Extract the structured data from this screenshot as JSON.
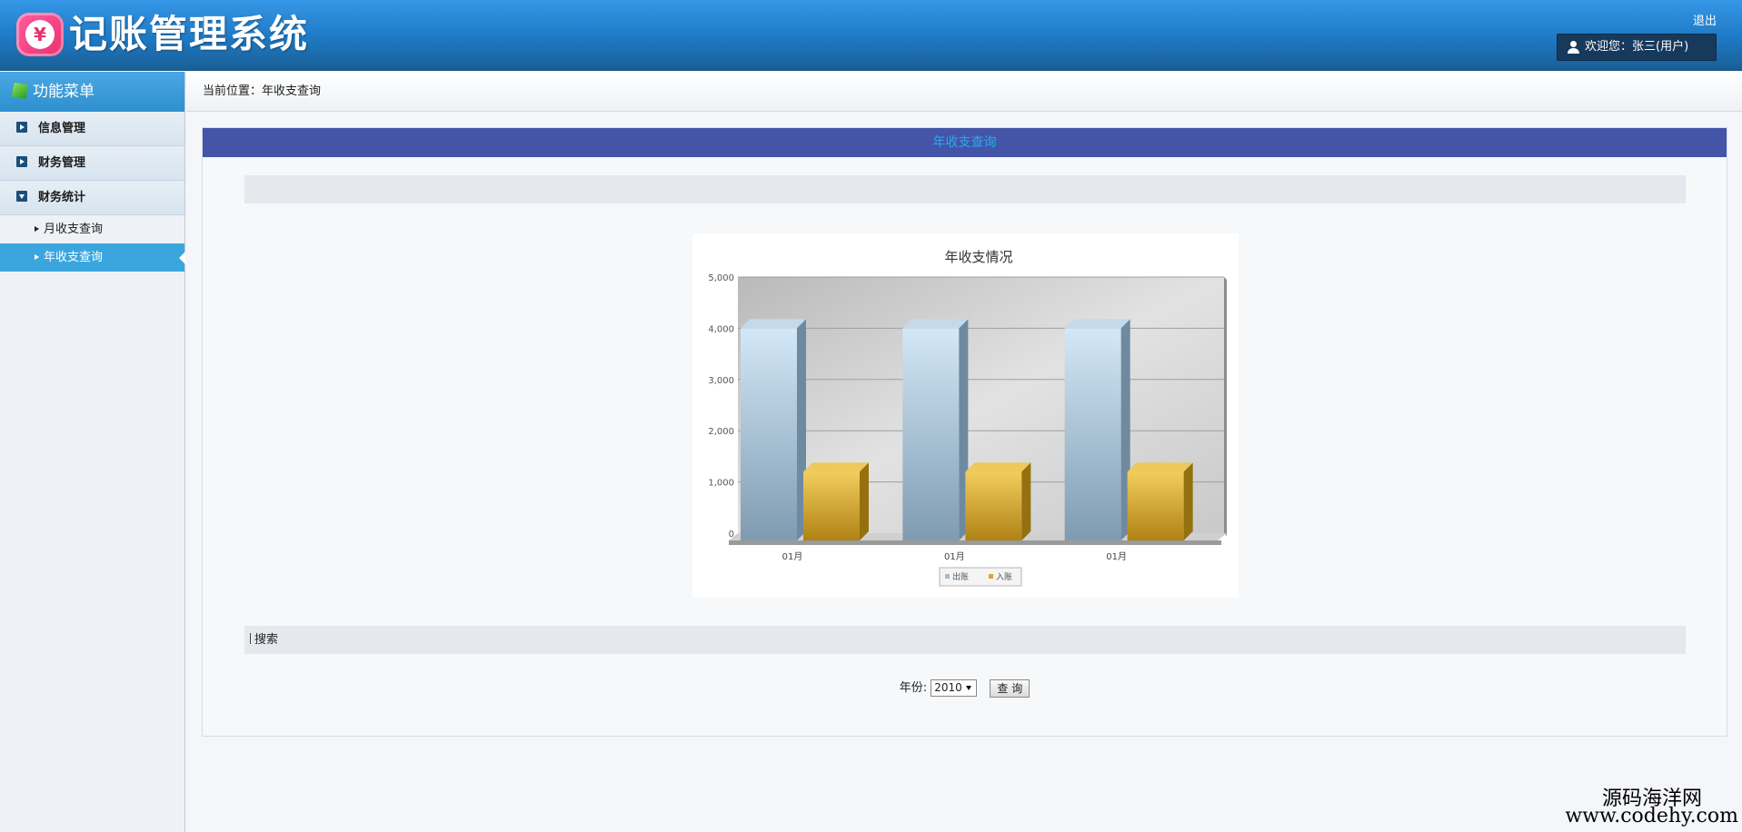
{
  "header": {
    "app_title": "记账管理系统",
    "logo_glyph": "¥",
    "logout_label": "退出",
    "welcome_text": "欢迎您：张三(用户)"
  },
  "sidebar": {
    "title": "功能菜单",
    "groups": [
      {
        "label": "信息管理",
        "expanded": false
      },
      {
        "label": "财务管理",
        "expanded": false
      },
      {
        "label": "财务统计",
        "expanded": true
      }
    ],
    "sub_items": [
      {
        "label": "月收支查询",
        "active": false
      },
      {
        "label": "年收支查询",
        "active": true
      }
    ]
  },
  "breadcrumb": {
    "text": "当前位置：年收支查询"
  },
  "panel": {
    "title": "年收支查询"
  },
  "search": {
    "section_label": "搜索",
    "year_label": "年份:",
    "year_value": "2010",
    "submit_label": "查 询"
  },
  "watermark": {
    "line1": "源码海洋网",
    "line2": "www.codehy.com"
  },
  "colors": {
    "expense": "#9fbad0",
    "income": "#d7a72a",
    "panel_head": "#4455a8",
    "accent": "#3aa6dd"
  },
  "chart_data": {
    "type": "bar",
    "title": "年收支情况",
    "categories": [
      "01月",
      "01月",
      "01月"
    ],
    "series": [
      {
        "name": "出账",
        "values": [
          4000,
          4000,
          4000
        ]
      },
      {
        "name": "入账",
        "values": [
          1200,
          1200,
          1200
        ]
      }
    ],
    "ylim": [
      0,
      5000
    ],
    "yticks": [
      "0",
      "1,000",
      "2,000",
      "3,000",
      "4,000",
      "5,000"
    ],
    "grid": true,
    "legend": "bottom"
  }
}
